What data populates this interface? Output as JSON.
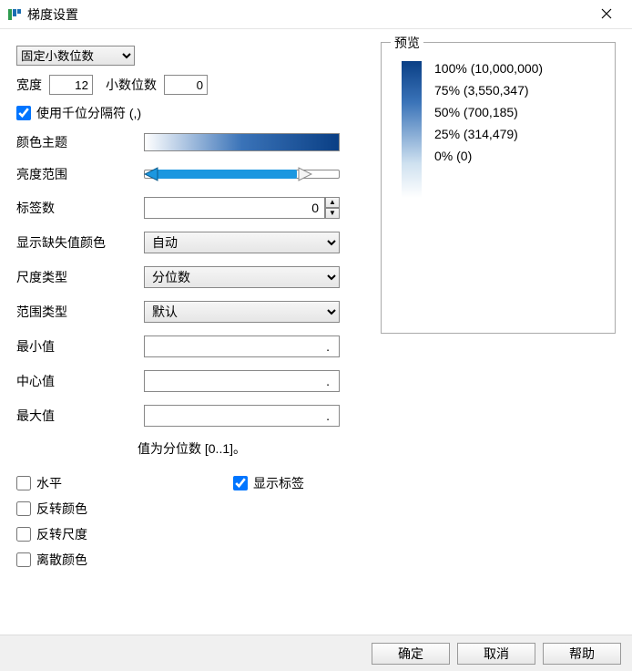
{
  "window": {
    "title": "梯度设置",
    "close_icon": "✕"
  },
  "format_select": "固定小数位数",
  "width_label": "宽度",
  "width_value": "12",
  "decimals_label": "小数位数",
  "decimals_value": "0",
  "thousand_sep_label": "使用千位分隔符 (,)",
  "thousand_sep_checked": true,
  "color_theme_label": "颜色主题",
  "brightness_label": "亮度范围",
  "labels_count_label": "标签数",
  "labels_count_value": "0",
  "missing_color_label": "显示缺失值颜色",
  "missing_color_value": "自动",
  "scale_type_label": "尺度类型",
  "scale_type_value": "分位数",
  "range_type_label": "范围类型",
  "range_type_value": "默认",
  "min_label": "最小值",
  "min_value": ".",
  "center_label": "中心值",
  "center_value": ".",
  "max_label": "最大值",
  "max_value": ".",
  "hint": "值为分位数 [0..1]。",
  "horizontal_label": "水平",
  "invert_colors_label": "反转颜色",
  "invert_scale_label": "反转尺度",
  "discrete_label": "离散颜色",
  "show_labels_label": "显示标签",
  "show_labels_checked": true,
  "preview": {
    "title": "预览",
    "items": [
      "100% (10,000,000)",
      "75% (3,550,347)",
      "50% (700,185)",
      "25% (314,479)",
      "0% (0)"
    ]
  },
  "buttons": {
    "ok": "确定",
    "cancel": "取消",
    "help": "帮助"
  }
}
